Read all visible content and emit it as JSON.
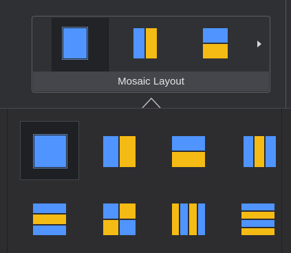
{
  "ribbon": {
    "group_label": "Mosaic Layout",
    "quick_layouts": [
      {
        "name": "single",
        "selected": true
      },
      {
        "name": "split-vertical",
        "selected": false
      },
      {
        "name": "split-horizontal",
        "selected": false
      }
    ],
    "scroll_icon": "triangle-right"
  },
  "dropdown": {
    "layouts": [
      {
        "name": "single",
        "selected": true
      },
      {
        "name": "split-vertical",
        "selected": false
      },
      {
        "name": "split-horizontal",
        "selected": false
      },
      {
        "name": "three-columns",
        "selected": false
      },
      {
        "name": "three-rows",
        "selected": false
      },
      {
        "name": "quad-grid",
        "selected": false
      },
      {
        "name": "four-columns",
        "selected": false
      },
      {
        "name": "four-rows",
        "selected": false
      }
    ]
  },
  "colors": {
    "pane_primary": "#4f94ff",
    "pane_secondary": "#f4bb14",
    "label_bar": "#44464b"
  }
}
